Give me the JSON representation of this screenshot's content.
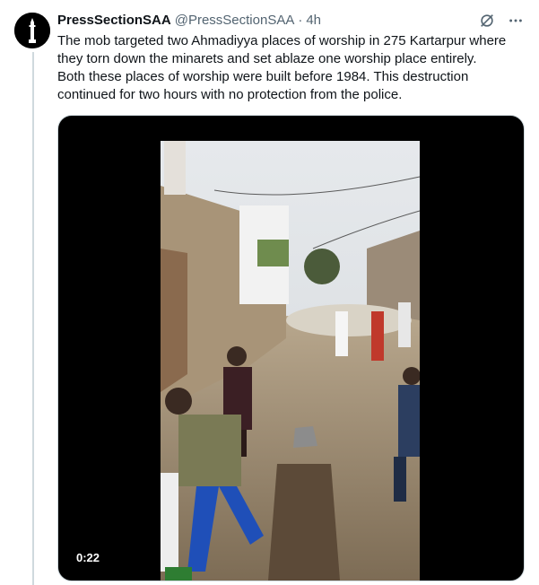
{
  "tweet": {
    "author_name": "PressSectionSAA",
    "author_handle": "@PressSectionSAA",
    "separator": "·",
    "time": "4h",
    "text_lines": [
      "The mob targeted two Ahmadiyya places of worship in 275 Kartarpur where",
      "they torn down the minarets and set ablaze one worship place entirely.",
      "Both these places of worship were built before 1984. This destruction",
      "continued for two hours with no protection from the police."
    ],
    "video_duration": "0:22"
  },
  "icons": {
    "avatar": "minaret-logo",
    "grok": "slashed-circle-icon",
    "more": "more-dots-icon"
  },
  "colors": {
    "text_primary": "#0f1419",
    "text_secondary": "#536471",
    "border": "#cfd9de"
  }
}
